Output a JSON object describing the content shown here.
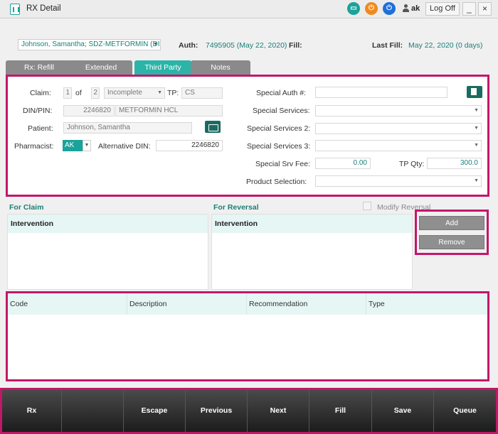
{
  "window": {
    "title": "RX Detail",
    "username": "ak",
    "logoff_label": "Log Off",
    "minimize": "_",
    "close": "×"
  },
  "header": {
    "patient_drug": "Johnson, Samantha; SDZ-METFORMIN (DII",
    "auth_label": "Auth:",
    "auth_value": "7495905 (May 22, 2020)",
    "fill_label": "Fill:",
    "last_fill_label": "Last Fill:",
    "last_fill_value": "May 22, 2020 (0 days)"
  },
  "tabs": [
    "Rx: Refill",
    "Extended",
    "Third Party",
    "Notes"
  ],
  "claim": {
    "claim_label": "Claim:",
    "claim_num": "1",
    "of_label": "of",
    "claim_total": "2",
    "status": "Incomplete",
    "tp_label": "TP:",
    "tp_value": "CS",
    "din_label": "DIN/PIN:",
    "din_value": "2246820",
    "drug_name": "METFORMIN HCL",
    "patient_label": "Patient:",
    "patient_value": "Johnson, Samantha",
    "pharmacist_label": "Pharmacist:",
    "pharmacist_value": "AK",
    "alt_din_label": "Alternative DIN:",
    "alt_din_value": "2246820",
    "special_auth_label": "Special Auth #:",
    "special_services_label": "Special Services:",
    "special_services2_label": "Special Services 2:",
    "special_services3_label": "Special Services 3:",
    "special_srv_fee_label": "Special Srv Fee:",
    "special_srv_fee_value": "0.00",
    "tp_qty_label": "TP Qty:",
    "tp_qty_value": "300.0",
    "product_selection_label": "Product Selection:"
  },
  "interventions": {
    "for_claim_label": "For Claim",
    "for_reversal_label": "For Reversal",
    "modify_reversal_label": "Modify Reversal",
    "claim_col": "Intervention",
    "reversal_col": "Intervention",
    "add_label": "Add",
    "remove_label": "Remove"
  },
  "grid": {
    "columns": [
      "Code",
      "Description",
      "Recommendation",
      "Type"
    ]
  },
  "footer": {
    "buttons": [
      "Rx",
      "",
      "Escape",
      "Previous",
      "Next",
      "Fill",
      "Save",
      "Queue"
    ]
  },
  "colors": {
    "accent": "#2bb5a8",
    "teal_text": "#1a7f77",
    "highlight_border": "#c2186a"
  },
  "icons": [
    "app-logo-icon",
    "monitor-icon",
    "power-icon",
    "power-icon",
    "user-icon",
    "folder-icon",
    "document-icon",
    "dropdown-caret-icon"
  ]
}
